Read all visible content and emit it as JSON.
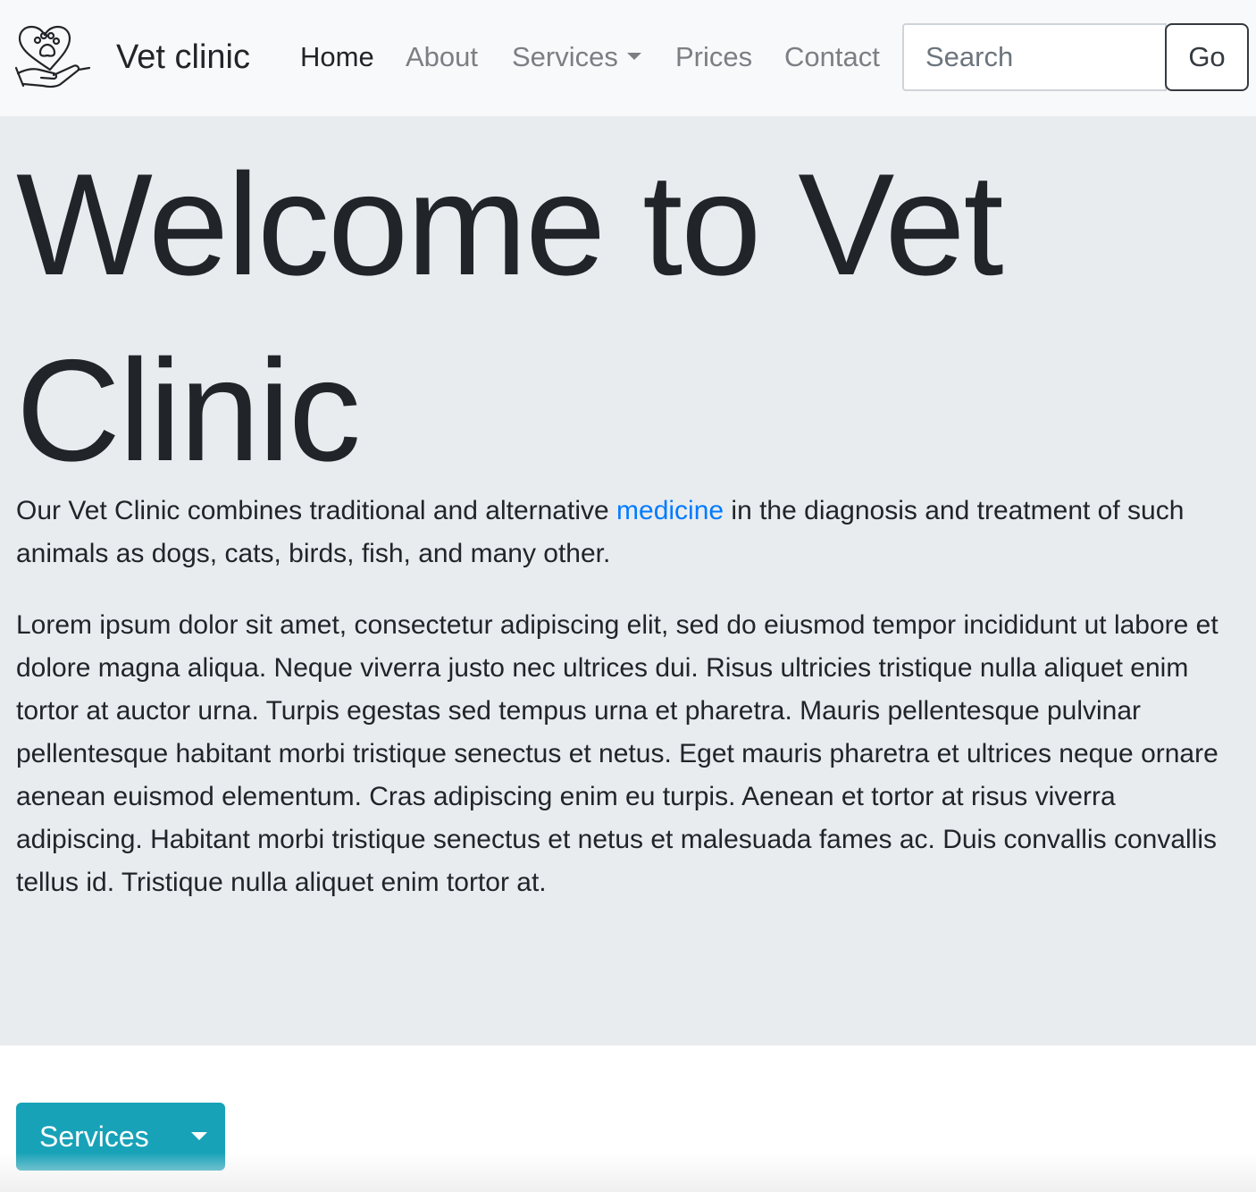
{
  "navbar": {
    "brand": "Vet clinic",
    "logo_icon": "paw-heart-hand-icon",
    "links": [
      {
        "label": "Home",
        "active": true
      },
      {
        "label": "About",
        "active": false
      },
      {
        "label": "Services",
        "active": false,
        "dropdown": true
      },
      {
        "label": "Prices",
        "active": false
      },
      {
        "label": "Contact",
        "active": false
      }
    ],
    "search_placeholder": "Search",
    "go_label": "Go"
  },
  "hero": {
    "title": "Welcome to Vet Clinic",
    "intro_before": "Our Vet Clinic combines traditional and alternative ",
    "intro_link": "medicine",
    "intro_after": " in the diagnosis and treatment of such animals as dogs, cats, birds, fish, and many other.",
    "lorem": "Lorem ipsum dolor sit amet, consectetur adipiscing elit, sed do eiusmod tempor incididunt ut labore et dolore magna aliqua. Neque viverra justo nec ultrices dui. Risus ultricies tristique nulla aliquet enim tortor at auctor urna. Turpis egestas sed tempus urna et pharetra. Mauris pellentesque pulvinar pellentesque habitant morbi tristique senectus et netus. Eget mauris pharetra et ultrices neque ornare aenean euismod elementum. Cras adipiscing enim eu turpis. Aenean et tortor at risus viverra adipiscing. Habitant morbi tristique senectus et netus et malesuada fames ac. Duis convallis convallis tellus id. Tristique nulla aliquet enim tortor at."
  },
  "services_button": {
    "label": "Services"
  },
  "colors": {
    "navbar_bg": "#f8f9fa",
    "jumbotron_bg": "#e9ecef",
    "link": "#007bff",
    "info_button": "#17a2b8",
    "nav_muted": "#7b7f84",
    "text_dark": "#212529"
  }
}
